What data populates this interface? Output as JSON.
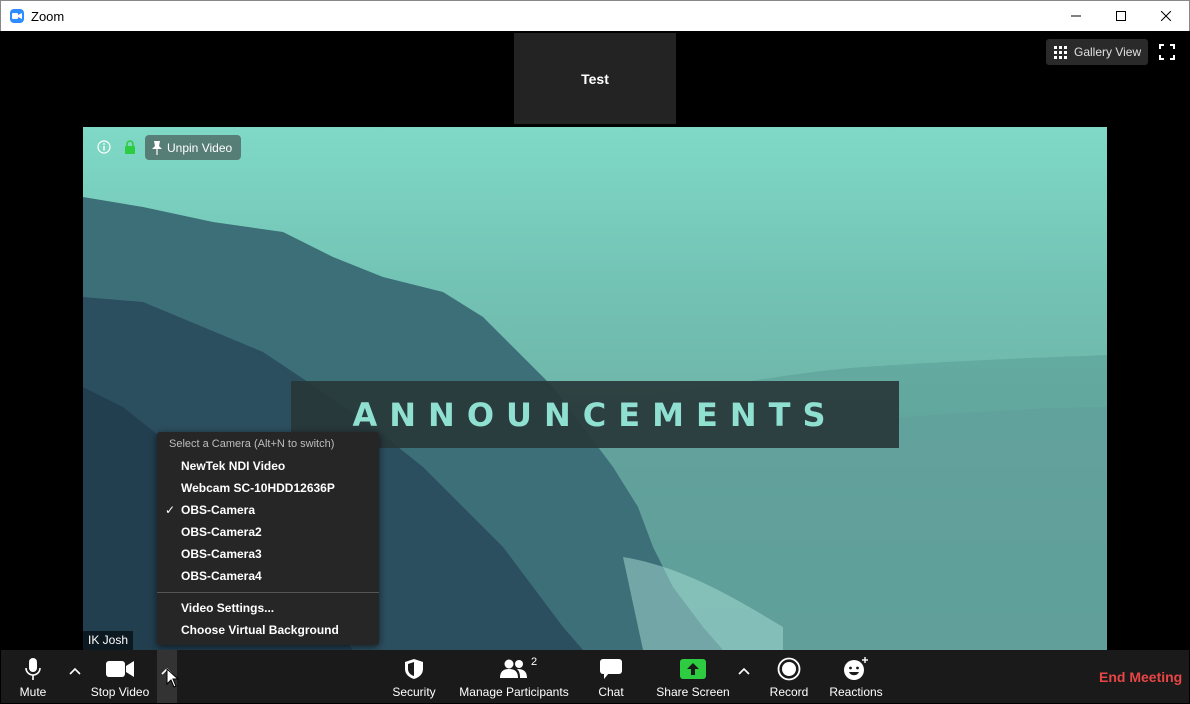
{
  "window": {
    "title": "Zoom"
  },
  "top_bar": {
    "thumbnail_name": "Test",
    "gallery_view_label": "Gallery View"
  },
  "video": {
    "unpin_label": "Unpin Video",
    "banner_text": "ANNOUNCEMENTS",
    "participant_name": "IK Josh"
  },
  "camera_menu": {
    "heading": "Select a Camera (Alt+N to switch)",
    "cameras": [
      "NewTek NDI Video",
      "Webcam SC-10HDD12636P",
      "OBS-Camera",
      "OBS-Camera2",
      "OBS-Camera3",
      "OBS-Camera4"
    ],
    "selected": "OBS-Camera",
    "check_glyph": "✓",
    "video_settings": "Video Settings...",
    "virtual_background": "Choose Virtual Background"
  },
  "toolbar": {
    "mute": "Mute",
    "stop_video": "Stop Video",
    "security": "Security",
    "manage_participants": "Manage Participants",
    "participant_count": "2",
    "chat": "Chat",
    "share_screen": "Share Screen",
    "record": "Record",
    "reactions": "Reactions",
    "end_meeting": "End Meeting"
  },
  "colors": {
    "zoom_blue": "#2d8cff",
    "share_green": "#2ecc40",
    "end_red": "#e84545"
  }
}
